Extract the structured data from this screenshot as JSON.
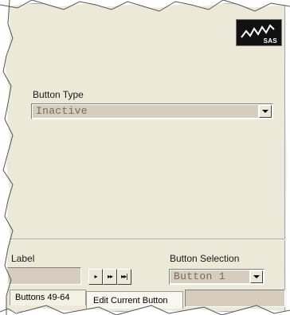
{
  "logo": {
    "text": "SAS"
  },
  "button_type": {
    "label": "Button Type",
    "selected": "Inactive"
  },
  "label_field": {
    "label": "Label",
    "value": ""
  },
  "nav_buttons": [
    {
      "symbol": "▸"
    },
    {
      "symbol": "▸▸"
    },
    {
      "symbol": "▸▸|"
    }
  ],
  "button_selection": {
    "label": "Button Selection",
    "selected": "Button 1"
  },
  "tabs": [
    {
      "label": "Buttons 49-64"
    },
    {
      "label": "Edit Current Button"
    }
  ],
  "colors": {
    "panel": "#ece9d8",
    "field": "#d6cdbf",
    "field_text": "#7a6a58",
    "logo_bg": "#111111"
  }
}
